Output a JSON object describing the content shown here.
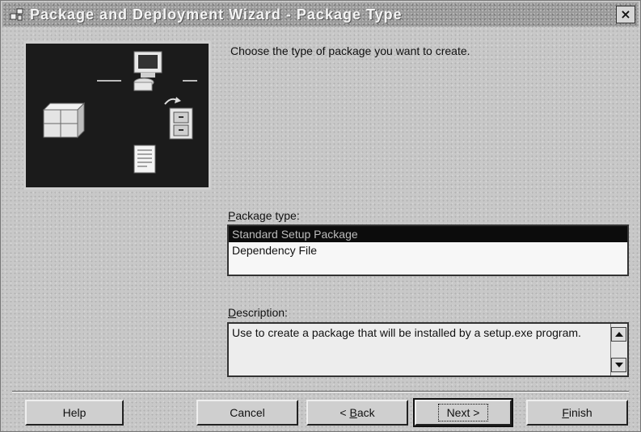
{
  "window": {
    "title": "Package and Deployment Wizard - Package Type",
    "close_glyph": "×"
  },
  "main": {
    "prompt": "Choose the type of package you want to create.",
    "package_type_label_key": "P",
    "package_type_label_rest": "ackage type:",
    "package_types": [
      {
        "label": "Standard Setup Package",
        "selected": true
      },
      {
        "label": "Dependency File",
        "selected": false
      }
    ],
    "description_label_key": "D",
    "description_label_rest": "escription:",
    "description_text": "Use to create a package that will be installed by a setup.exe program."
  },
  "buttons": {
    "help": "Help",
    "cancel": "Cancel",
    "back_prefix": "< ",
    "back_key": "B",
    "back_rest": "ack",
    "next": "Next >",
    "finish_key": "F",
    "finish_rest": "inish"
  },
  "icons": {
    "app": "wizard-app-icon",
    "illustration": [
      "computer-icon",
      "package-box-icon",
      "file-cabinet-icon",
      "document-icon",
      "arrow-icon"
    ],
    "scroll_up": "scroll-up-arrow-icon",
    "scroll_down": "scroll-down-arrow-icon"
  }
}
